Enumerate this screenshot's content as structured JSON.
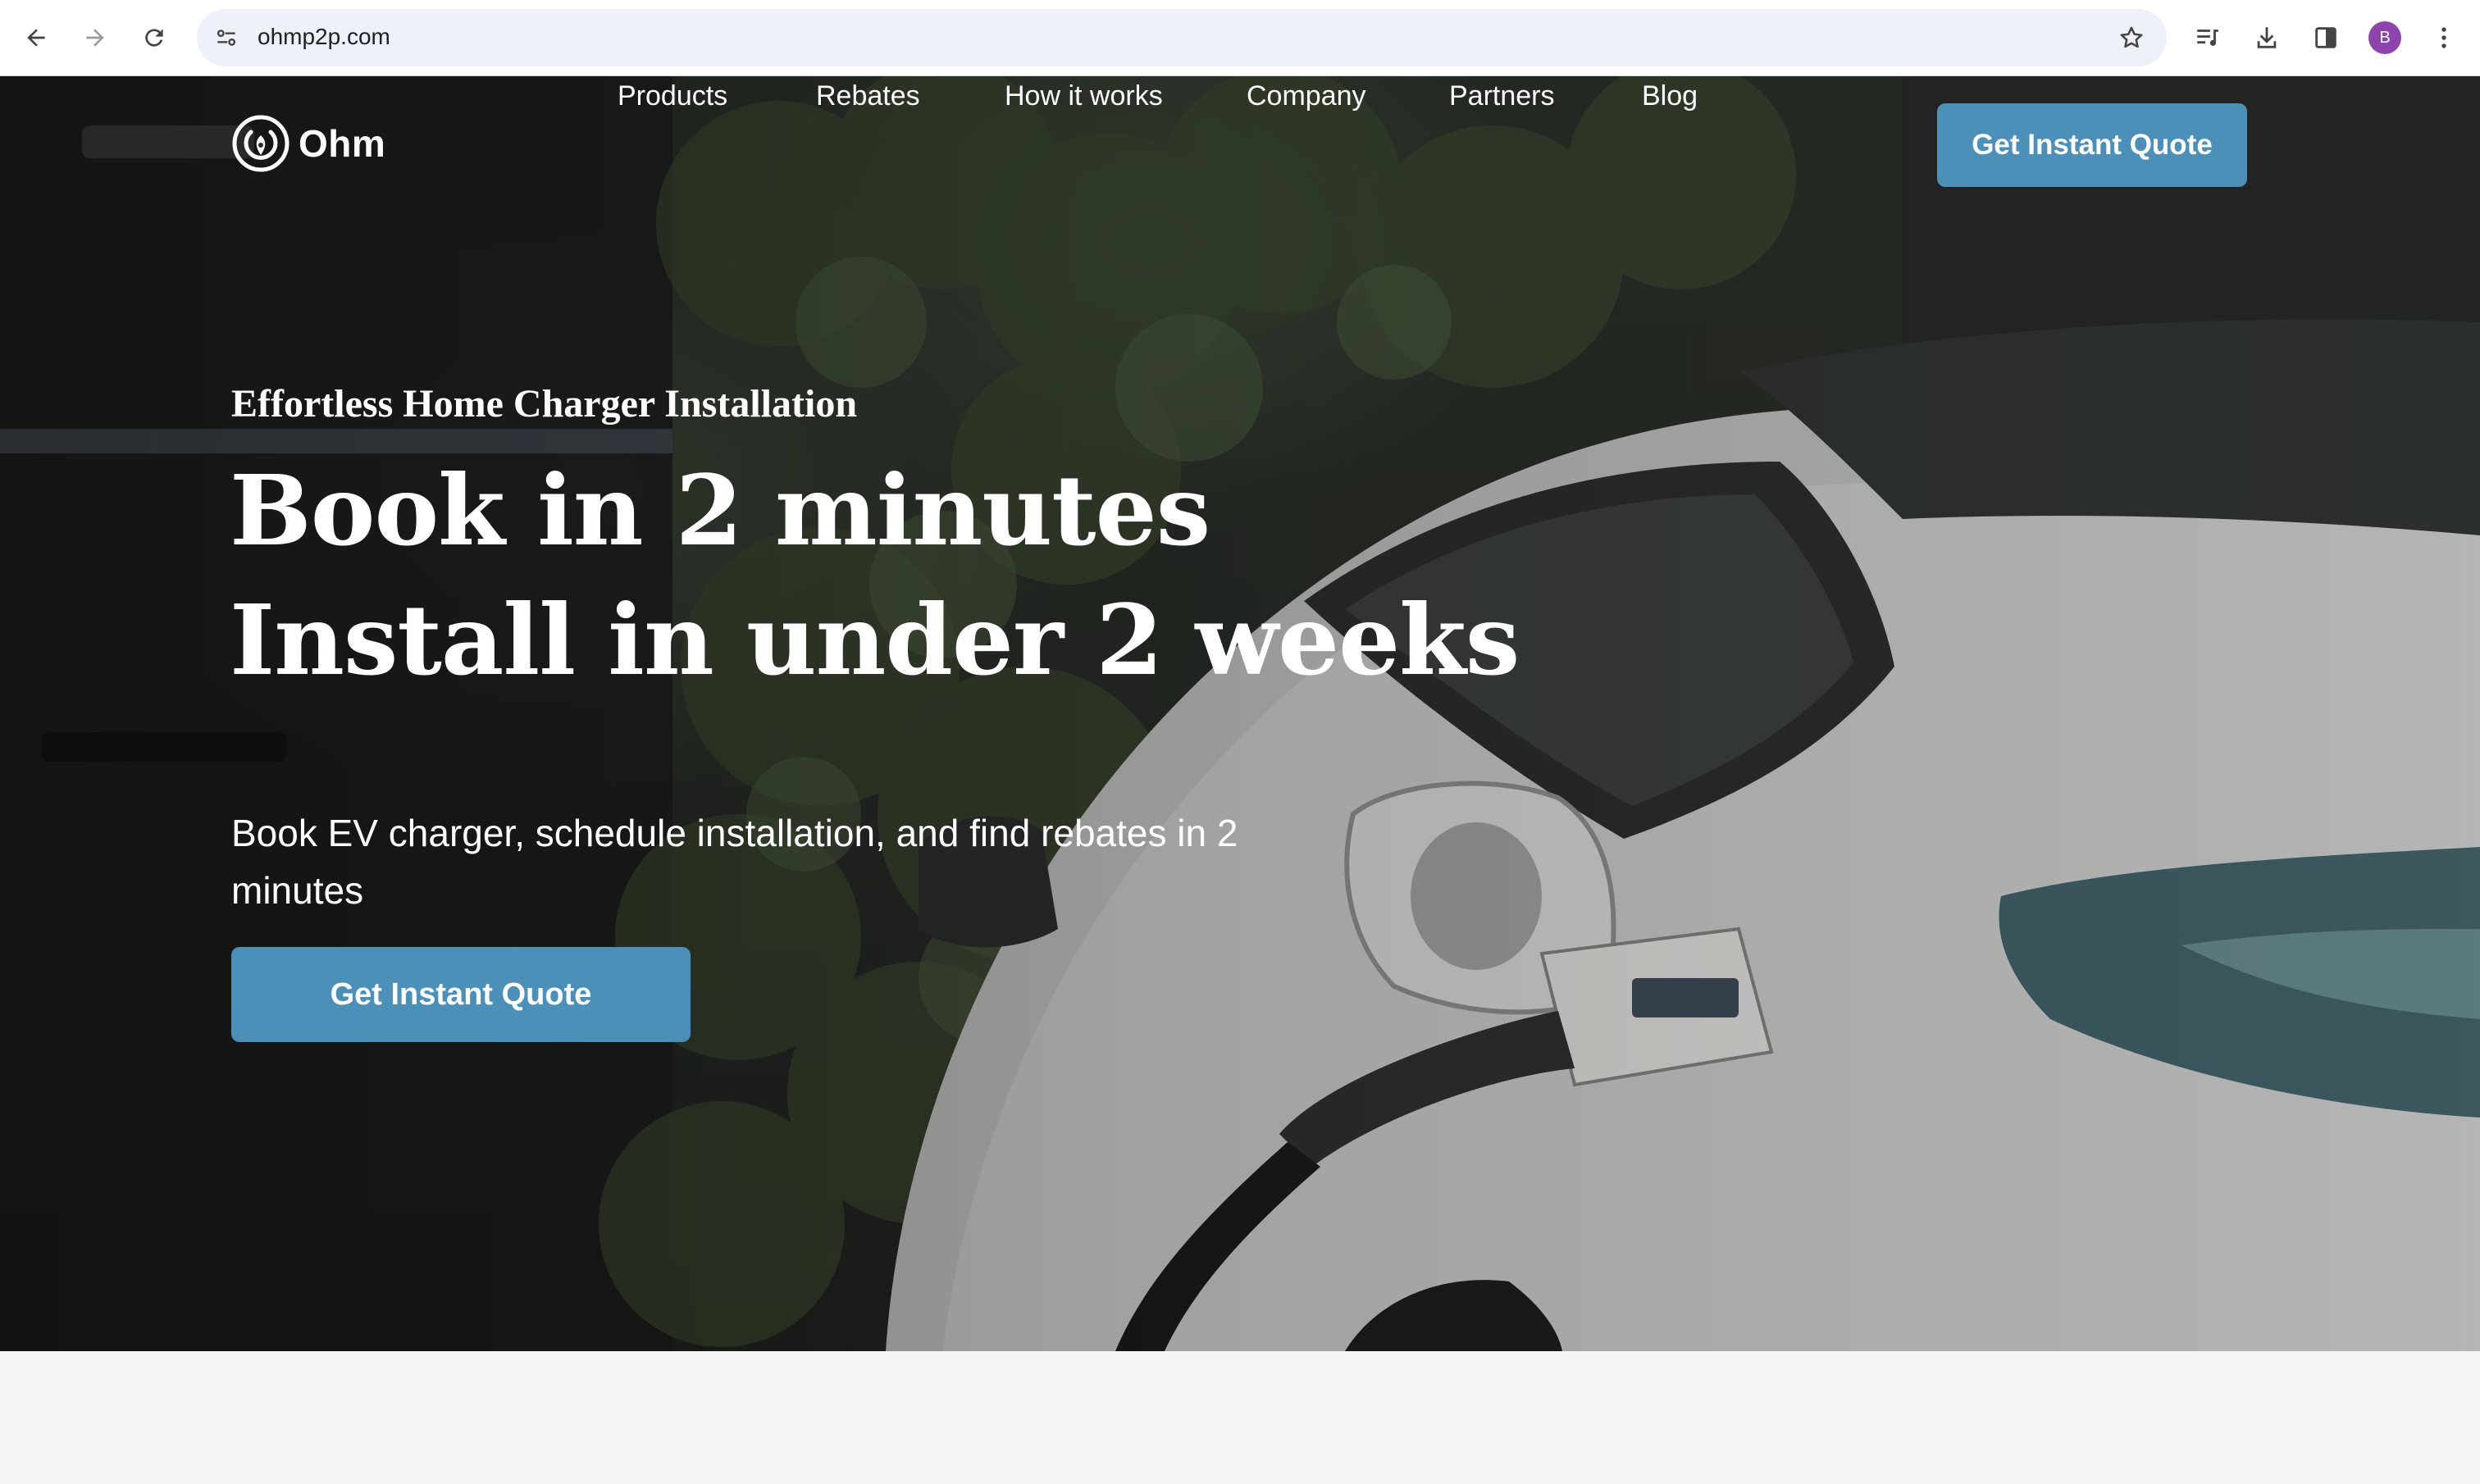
{
  "browser": {
    "url": "ohmp2p.com",
    "profile_initial": "B",
    "icons": {
      "back": "arrow-left-icon",
      "forward": "arrow-right-icon",
      "reload": "reload-icon",
      "site_info": "tune-icon",
      "bookmark": "star-icon",
      "media": "media-control-icon",
      "downloads": "download-icon",
      "side_panel": "side-panel-icon",
      "menu": "kebab-menu-icon"
    },
    "avatar_color": "#8e44ad"
  },
  "site": {
    "brand": "Ohm",
    "nav": {
      "links": [
        "Products",
        "Rebates",
        "How it works",
        "Company",
        "Partners",
        "Blog"
      ],
      "cta": "Get Instant Quote"
    },
    "hero": {
      "eyebrow": "Effortless Home Charger Installation",
      "headline_1": "Book in 2 minutes",
      "headline_2": "Install in under 2 weeks",
      "subcopy": "Book EV charger, schedule installation, and find rebates in 2 minutes",
      "cta": "Get Instant Quote"
    },
    "colors": {
      "accent": "#4a90b8",
      "text_on_dark": "#ffffff",
      "below_fold_bg": "#f4f4f4"
    }
  }
}
